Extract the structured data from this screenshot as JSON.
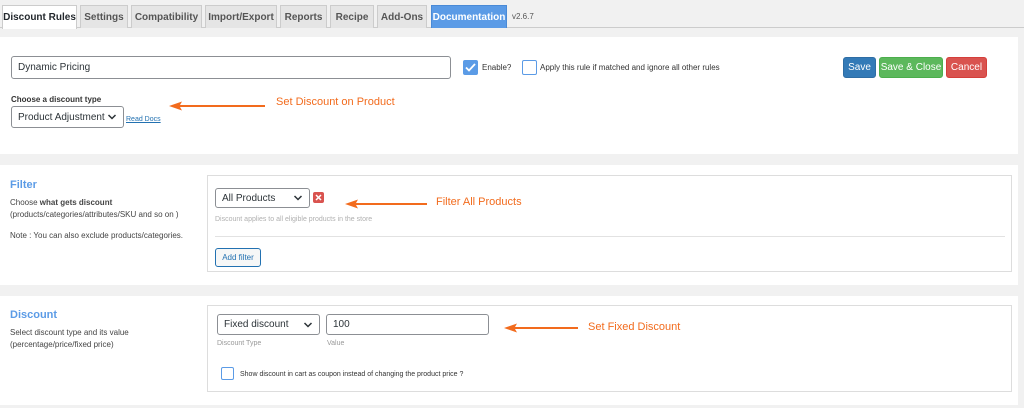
{
  "tabs": [
    {
      "label": "Discount Rules"
    },
    {
      "label": "Settings"
    },
    {
      "label": "Compatibility"
    },
    {
      "label": "Import/Export"
    },
    {
      "label": "Reports"
    },
    {
      "label": "Recipe"
    },
    {
      "label": "Add-Ons"
    },
    {
      "label": "Documentation"
    }
  ],
  "version": "v2.6.7",
  "rule": {
    "name_value": "Dynamic Pricing",
    "enable_label": "Enable?",
    "enable_checked": true,
    "exclusive_label": "Apply this rule if matched and ignore all other rules",
    "exclusive_checked": false,
    "discount_type_label": "Choose a discount type",
    "discount_type_value": "Product Adjustment",
    "read_docs": "Read Docs",
    "save": "Save",
    "save_close": "Save & Close",
    "cancel": "Cancel"
  },
  "filter": {
    "title": "Filter",
    "desc_prefix": "Choose ",
    "desc_bold": "what gets discount",
    "desc_line2": "(products/categories/attributes/SKU and so on )",
    "note": "Note : You can also exclude products/categories.",
    "select_value": "All Products",
    "help": "Discount applies to all eligible products in the store",
    "add_filter": "Add filter"
  },
  "discount": {
    "title": "Discount",
    "desc_line1": "Select discount type and its value",
    "desc_line2": "(percentage/price/fixed price)",
    "type_value": "Fixed discount",
    "type_caption": "Discount Type",
    "value": "100",
    "value_caption": "Value",
    "coupon_label": "Show discount in cart as coupon instead of changing the product price ?",
    "coupon_checked": false
  },
  "annotations": {
    "discount_type": "Set Discount on Product",
    "filter": "Filter All Products",
    "fixed": "Set Fixed Discount"
  },
  "colors": {
    "annotation": "#f26b1d",
    "accent": "#5b9be6",
    "save": "#337ab7",
    "save_close": "#5cb85c",
    "cancel": "#d9534f"
  }
}
